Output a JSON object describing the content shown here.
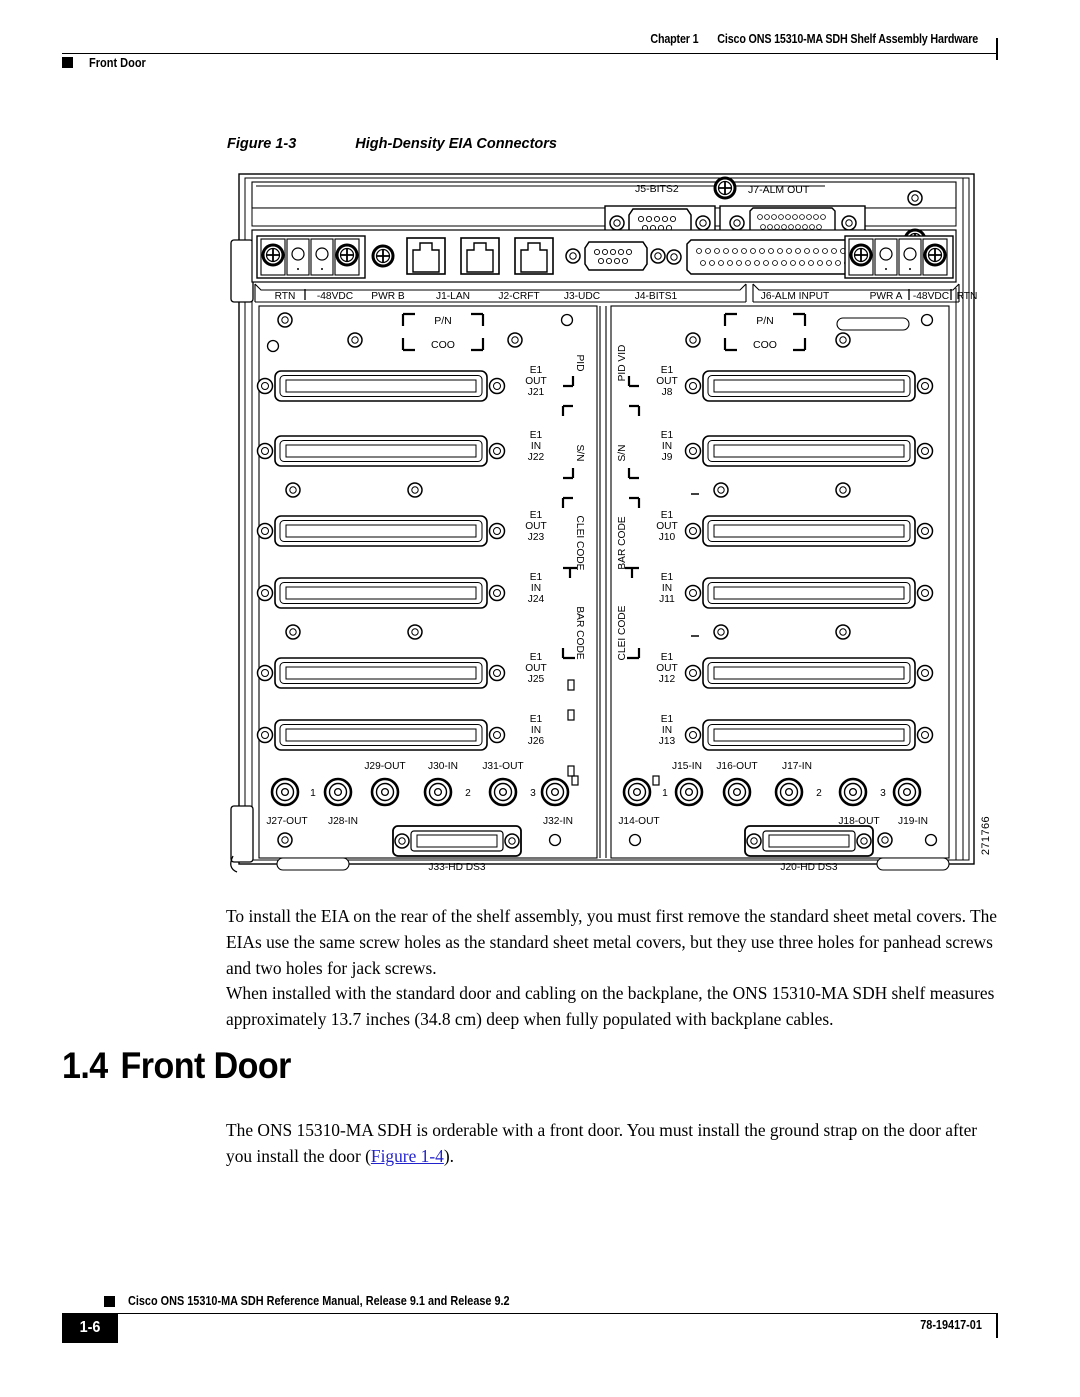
{
  "header": {
    "chapter_label": "Chapter 1",
    "chapter_title": "Cisco ONS 15310-MA SDH Shelf Assembly Hardware",
    "section_marker": "Front Door"
  },
  "figure": {
    "number": "Figure 1-3",
    "title": "High-Density EIA Connectors",
    "art_id": "271766",
    "top_connectors": {
      "j5": "J5-BITS2",
      "j7": "J7-ALM OUT",
      "j6": "J6-ALM INPUT"
    },
    "port_strip_left": [
      "RTN",
      "-48VDC",
      "PWR B",
      "J1-LAN",
      "J2-CRFT",
      "J3-UDC",
      "J4-BITS1"
    ],
    "port_strip_right": [
      "J6-ALM INPUT",
      "PWR A",
      "-48VDC",
      "RTN"
    ],
    "label_marks": {
      "pn": "P/N",
      "coo": "COO"
    },
    "vertical_labels_left": [
      "PID",
      "S/N",
      "CLEI CODE",
      "BAR CODE"
    ],
    "vertical_labels_right": [
      "PID VID",
      "S/N",
      "BAR CODE",
      "CLEI CODE"
    ],
    "left_panel_connectors": [
      {
        "line1": "E1",
        "line2": "OUT",
        "line3": "J21"
      },
      {
        "line1": "E1",
        "line2": "IN",
        "line3": "J22"
      },
      {
        "line1": "E1",
        "line2": "OUT",
        "line3": "J23"
      },
      {
        "line1": "E1",
        "line2": "IN",
        "line3": "J24"
      },
      {
        "line1": "E1",
        "line2": "OUT",
        "line3": "J25"
      },
      {
        "line1": "E1",
        "line2": "IN",
        "line3": "J26"
      }
    ],
    "right_panel_connectors": [
      {
        "line1": "E1",
        "line2": "OUT",
        "line3": "J8"
      },
      {
        "line1": "E1",
        "line2": "IN",
        "line3": "J9"
      },
      {
        "line1": "E1",
        "line2": "OUT",
        "line3": "J10"
      },
      {
        "line1": "E1",
        "line2": "IN",
        "line3": "J11"
      },
      {
        "line1": "E1",
        "line2": "OUT",
        "line3": "J12"
      },
      {
        "line1": "E1",
        "line2": "IN",
        "line3": "J13"
      }
    ],
    "bnc_left": {
      "above": [
        "J29-OUT",
        "J30-IN",
        "J31-OUT"
      ],
      "below": [
        "J27-OUT",
        "J28-IN",
        "J32-IN"
      ],
      "group_numbers": [
        "1",
        "2",
        "3"
      ]
    },
    "bnc_right": {
      "above": [
        "J15-IN",
        "J16-OUT",
        "J17-IN"
      ],
      "below": [
        "J14-OUT",
        "J18-OUT",
        "J19-IN"
      ],
      "group_numbers": [
        "1",
        "2",
        "3"
      ]
    },
    "hd_ds3_left": "J33-HD DS3",
    "hd_ds3_right": "J20-HD DS3"
  },
  "body": {
    "para_install": "To install the EIA on the rear of the shelf assembly, you must first remove the standard sheet metal covers. The EIAs use the same screw holes as the standard sheet metal covers, but they use three holes for panhead screws and two holes for jack screws.",
    "para_depth": "When installed with the standard door and cabling on the backplane, the ONS 15310-MA SDH shelf measures approximately 13.7 inches (34.8 cm) deep when fully populated with backplane cables.",
    "para_frontdoor_before": "The ONS 15310-MA SDH is orderable with a front door. You must install the ground strap on the door after you install the door (",
    "para_frontdoor_link": "Figure 1-4",
    "para_frontdoor_after": ")."
  },
  "section": {
    "number": "1.4",
    "title": "Front Door"
  },
  "footer": {
    "manual_title": "Cisco ONS 15310-MA SDH Reference Manual, Release 9.1 and Release 9.2",
    "page_number": "1-6",
    "doc_number": "78-19417-01"
  }
}
